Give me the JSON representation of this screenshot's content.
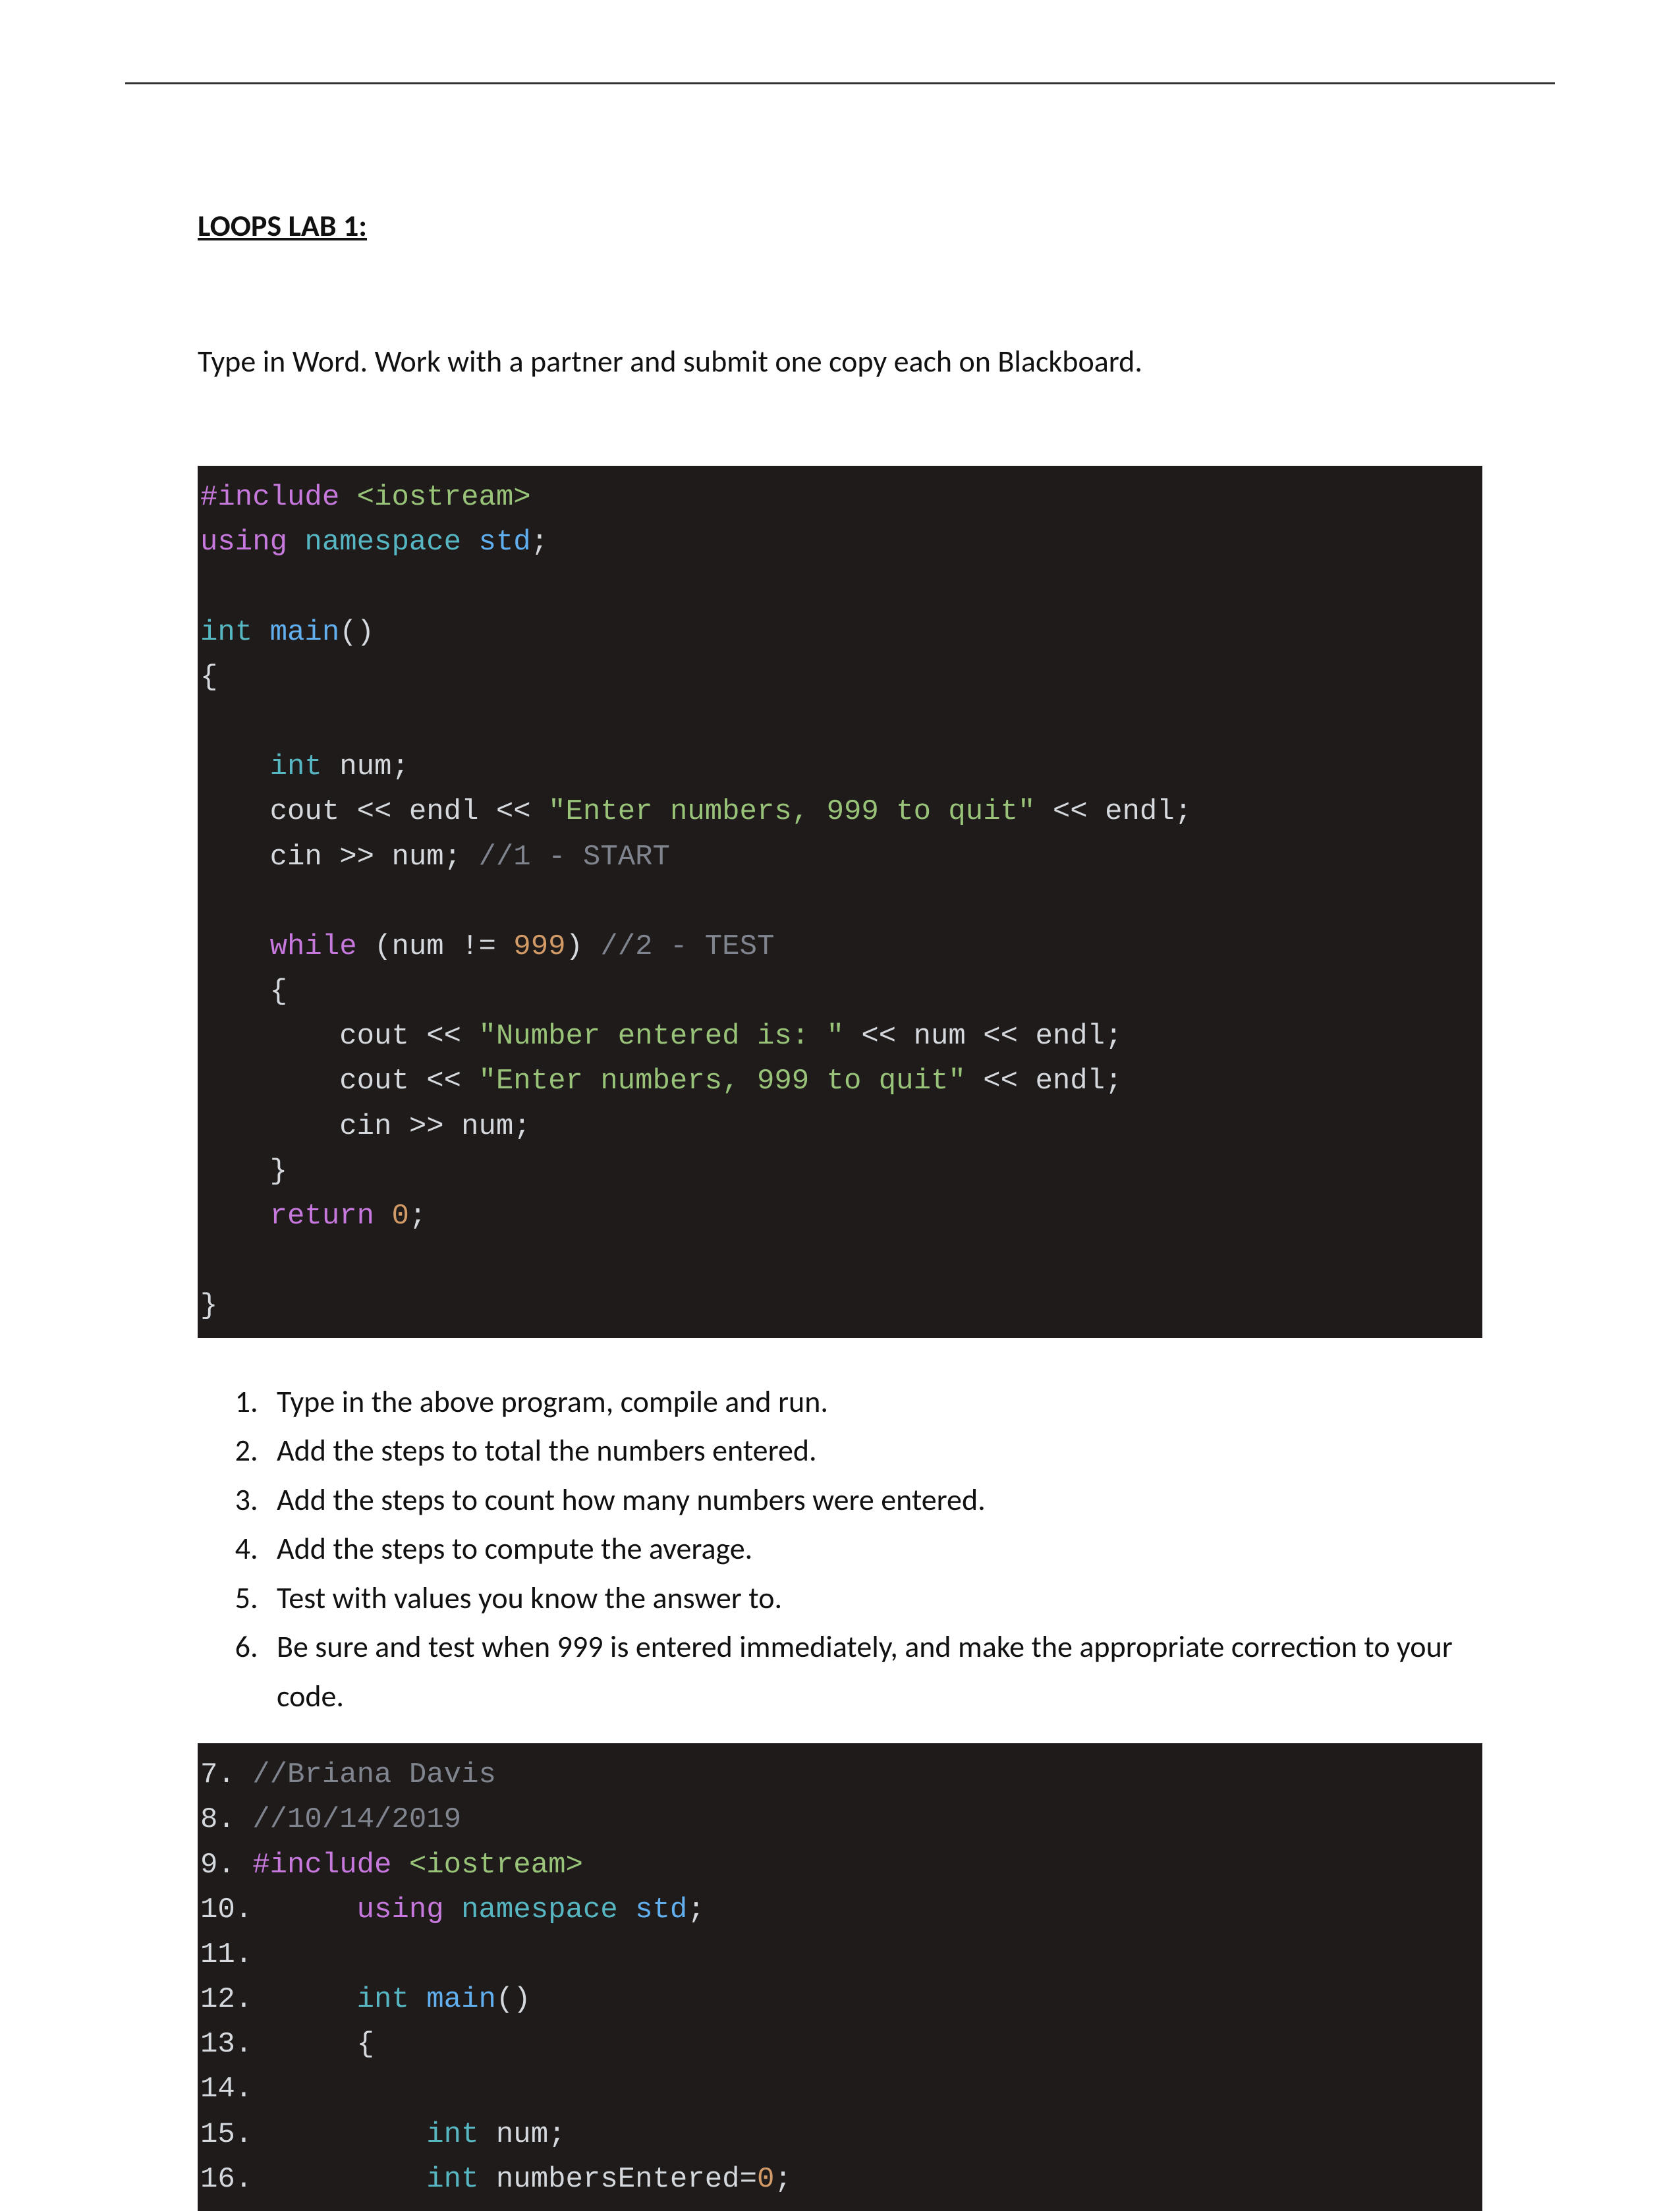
{
  "title": "LOOPS LAB 1:",
  "intro": "Type in Word. Work with a partner and submit one copy each on Blackboard.",
  "code1": {
    "l1_a": "#include",
    "l1_b": " <iostream>",
    "l2_a": "using",
    "l2_b": " namespace",
    "l2_c": " std",
    "l2_d": ";",
    "l3_a": "int",
    "l3_b": " main",
    "l3_c": "()",
    "l4": "{",
    "l5_a": "    int",
    "l5_b": " num",
    "l5_c": ";",
    "l6_a": "    cout ",
    "l6_b": "<<",
    "l6_c": " endl ",
    "l6_d": "<<",
    "l6_e": " \"Enter numbers, 999 to quit\"",
    "l6_f": " << ",
    "l6_g": "endl",
    "l6_h": ";",
    "l7_a": "    cin ",
    "l7_b": ">>",
    "l7_c": " num",
    "l7_d": "; ",
    "l7_e": "//1 - START",
    "l8_a": "    while",
    "l8_b": " (num ",
    "l8_c": "!=",
    "l8_d": " 999",
    "l8_e": ") ",
    "l8_f": "//2 - TEST",
    "l9": "    {",
    "l10_a": "        cout ",
    "l10_b": "<<",
    "l10_c": " \"Number entered is: \"",
    "l10_d": " << ",
    "l10_e": "num",
    "l10_f": " << ",
    "l10_g": "endl",
    "l10_h": ";",
    "l11_a": "        cout ",
    "l11_b": "<<",
    "l11_c": " \"Enter numbers, 999 to quit\"",
    "l11_d": " << ",
    "l11_e": "endl",
    "l11_f": ";",
    "l12_a": "        cin ",
    "l12_b": ">>",
    "l12_c": " num",
    "l12_d": ";",
    "l13": "    }",
    "l14_a": "    return",
    "l14_b": " 0",
    "l14_c": ";",
    "l15": "}"
  },
  "steps": [
    "Type in the above program, compile and run.",
    "Add the steps to total the numbers entered.",
    "Add the steps to count how many numbers were entered.",
    "Add the steps to compute the average.",
    "Test with values you know the answer to.",
    "Be sure and test when 999 is entered immediately, and make the appropriate correction to your code."
  ],
  "code2": {
    "n7": "7.",
    "c7": " //Briana Davis",
    "n8": "8.",
    "c8": " //10/14/2019",
    "n9": "9.",
    "c9a": " #include",
    "c9b": " <iostream>",
    "n10": "10.",
    "c10a": "      using",
    "c10b": " namespace",
    "c10c": " std",
    "c10d": ";",
    "n11": "11.",
    "n12": "12.",
    "c12a": "      int",
    "c12b": " main",
    "c12c": "()",
    "n13": "13.",
    "c13": "      {",
    "n14": "14.",
    "n15": "15.",
    "c15a": "          int",
    "c15b": " num",
    "c15c": ";",
    "n16": "16.",
    "c16a": "          int",
    "c16b": " numbersEntered",
    "c16c": "=",
    "c16d": "0",
    "c16e": ";"
  }
}
